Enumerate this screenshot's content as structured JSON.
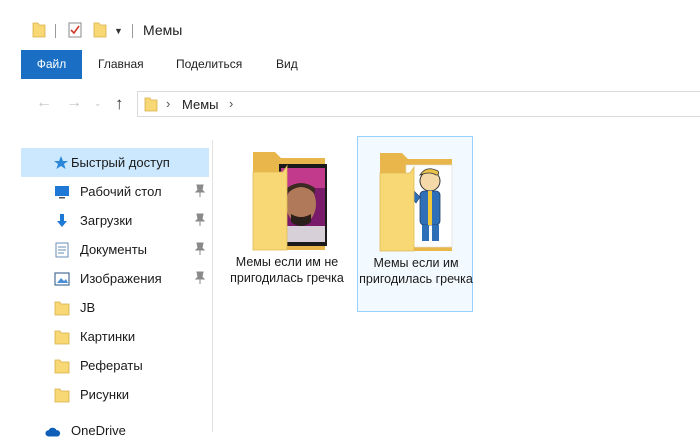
{
  "window": {
    "title": "Мемы"
  },
  "ribbon": {
    "tabs": [
      {
        "label": "Файл"
      },
      {
        "label": "Главная"
      },
      {
        "label": "Поделиться"
      },
      {
        "label": "Вид"
      }
    ]
  },
  "address": {
    "path": "Мемы"
  },
  "sidebar": {
    "items": [
      {
        "label": "Быстрый доступ",
        "icon": "star-icon"
      },
      {
        "label": "Рабочий стол",
        "icon": "desktop-icon"
      },
      {
        "label": "Загрузки",
        "icon": "download-icon"
      },
      {
        "label": "Документы",
        "icon": "documents-icon"
      },
      {
        "label": "Изображения",
        "icon": "pictures-icon"
      },
      {
        "label": "JB",
        "icon": "folder-icon"
      },
      {
        "label": "Картинки",
        "icon": "folder-icon"
      },
      {
        "label": "Рефераты",
        "icon": "folder-icon"
      },
      {
        "label": "Рисунки",
        "icon": "folder-icon"
      },
      {
        "label": "OneDrive",
        "icon": "cloud-icon"
      }
    ]
  },
  "files": [
    {
      "name": "Мемы если им не пригодилась гречка",
      "thumbnail": "man-photo-thumbnail"
    },
    {
      "name": "Мемы если им пригодилась гречка",
      "thumbnail": "vault-boy-thumbnail"
    }
  ],
  "colors": {
    "accent": "#1a6fc5",
    "selection": "#cce8ff",
    "folder": "#f8d775"
  }
}
